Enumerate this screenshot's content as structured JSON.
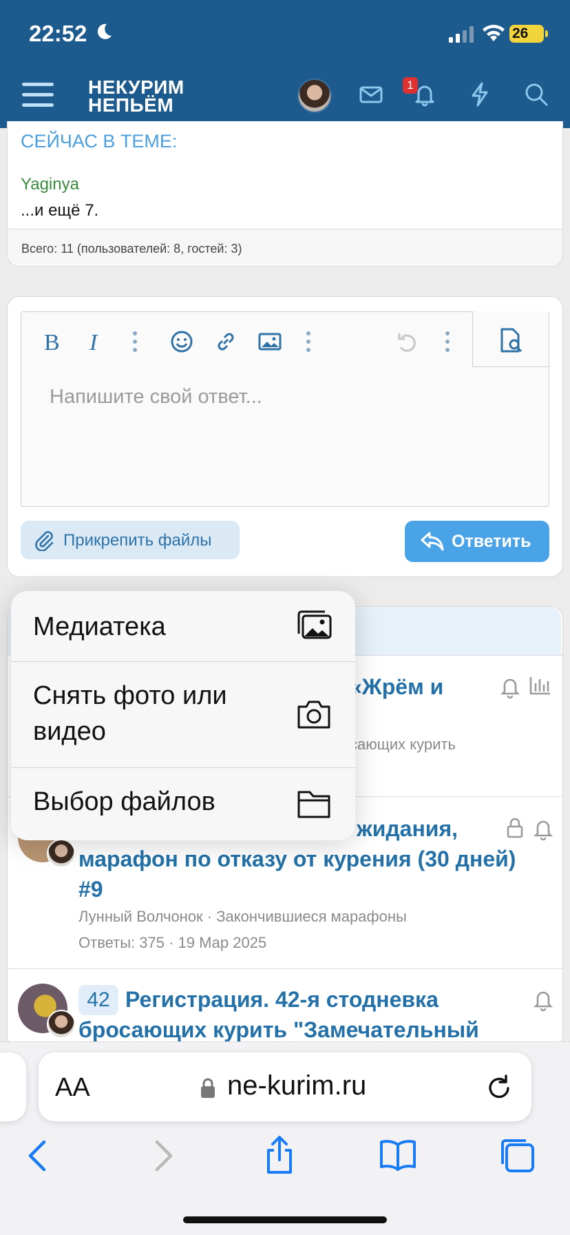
{
  "status_bar": {
    "time": "22:52",
    "battery": "26"
  },
  "header": {
    "logo_line1": "НЕКУРИМ",
    "logo_line2": "НЕПЬЁМ",
    "notifications_count": "1"
  },
  "online": {
    "title": "СЕЙЧАС В ТЕМЕ:",
    "user": "Yaginya",
    "more": "...и ещё 7.",
    "total": "Всего: 11 (пользователей: 8, гостей: 3)"
  },
  "editor": {
    "placeholder": "Напишите свой ответ...",
    "attach_label": "Прикрепить файлы",
    "reply_label": "Ответить"
  },
  "threads": [
    {
      "title_visible": "«Жрём и",
      "meta_visible": "сающих курить"
    },
    {
      "title_line1": "жидания,",
      "title_line2": "марафон по отказу от курения (30 дней)",
      "title_line3": "#9",
      "meta1": "Лунный Волчонок · Закончившиеся марафоны",
      "meta2": "Ответы: 375 · 19 Мар 2025"
    },
    {
      "badge": "42",
      "title_line1": "Регистрация. 42-я стодневка",
      "title_line2": "бросающих курить \"Замечательный"
    }
  ],
  "popup_menu": [
    {
      "label": "Медиатека",
      "icon": "photo-library-icon"
    },
    {
      "label": "Снять фото или видео",
      "icon": "camera-icon"
    },
    {
      "label": "Выбор файлов",
      "icon": "folder-icon"
    }
  ],
  "browser": {
    "aa": "AA",
    "url": "ne-kurim.ru"
  }
}
